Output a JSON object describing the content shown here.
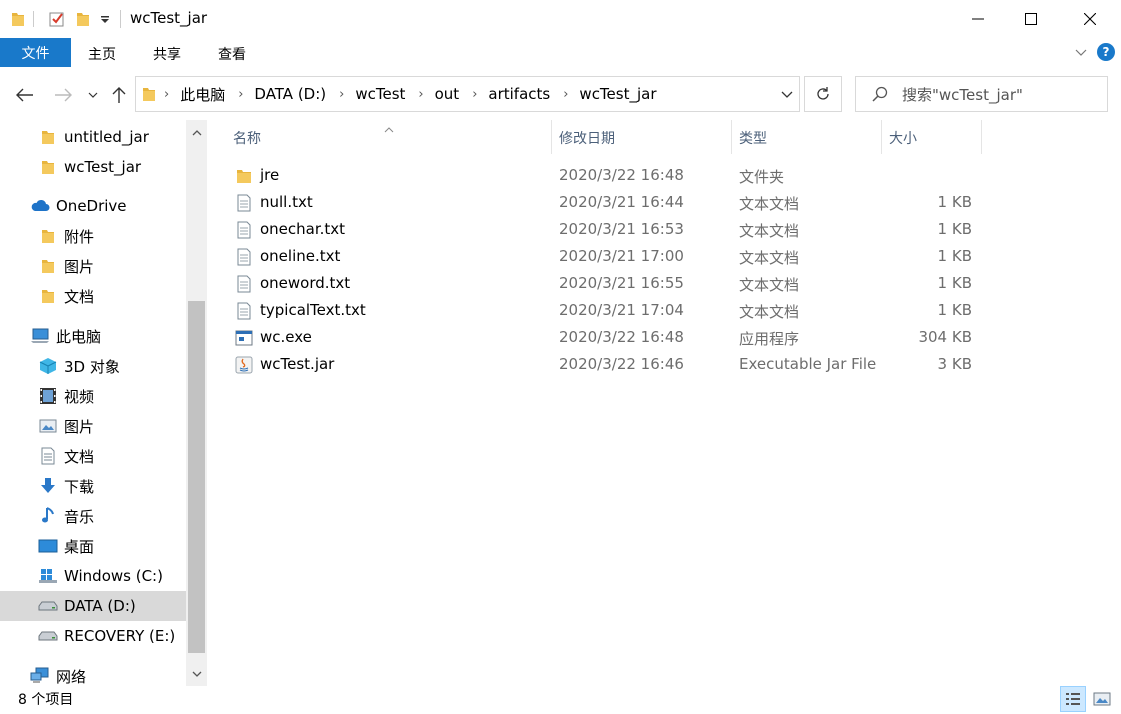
{
  "window": {
    "title": "wcTest_jar",
    "minimize": "—",
    "maximize": "☐",
    "close": "✕"
  },
  "ribbon": {
    "tabs": [
      "文件",
      "主页",
      "共享",
      "查看"
    ],
    "help": "?"
  },
  "address": {
    "crumbs": [
      "此电脑",
      "DATA (D:)",
      "wcTest",
      "out",
      "artifacts",
      "wcTest_jar"
    ]
  },
  "search": {
    "placeholder": "搜索\"wcTest_jar\""
  },
  "sidebar": {
    "items": [
      {
        "label": "untitled_jar",
        "icon": "folder-icon"
      },
      {
        "label": "wcTest_jar",
        "icon": "folder-icon"
      },
      {
        "label": "OneDrive",
        "icon": "cloud-icon"
      },
      {
        "label": "附件",
        "icon": "folder-icon"
      },
      {
        "label": "图片",
        "icon": "folder-icon"
      },
      {
        "label": "文档",
        "icon": "folder-icon"
      },
      {
        "label": "此电脑",
        "icon": "computer-icon"
      },
      {
        "label": "3D 对象",
        "icon": "3d-objects-icon"
      },
      {
        "label": "视频",
        "icon": "video-icon"
      },
      {
        "label": "图片",
        "icon": "pictures-icon"
      },
      {
        "label": "文档",
        "icon": "documents-icon"
      },
      {
        "label": "下载",
        "icon": "download-icon"
      },
      {
        "label": "音乐",
        "icon": "music-icon"
      },
      {
        "label": "桌面",
        "icon": "desktop-icon"
      },
      {
        "label": "Windows (C:)",
        "icon": "windows-drive-icon"
      },
      {
        "label": "DATA (D:)",
        "icon": "drive-icon"
      },
      {
        "label": "RECOVERY (E:)",
        "icon": "drive-icon"
      },
      {
        "label": "网络",
        "icon": "network-icon"
      }
    ]
  },
  "columns": {
    "name": "名称",
    "date": "修改日期",
    "type": "类型",
    "size": "大小"
  },
  "files": [
    {
      "name": "jre",
      "date": "2020/3/22 16:48",
      "type": "文件夹",
      "size": "",
      "icon": "folder-icon"
    },
    {
      "name": "null.txt",
      "date": "2020/3/21 16:44",
      "type": "文本文档",
      "size": "1 KB",
      "icon": "text-file-icon"
    },
    {
      "name": "onechar.txt",
      "date": "2020/3/21 16:53",
      "type": "文本文档",
      "size": "1 KB",
      "icon": "text-file-icon"
    },
    {
      "name": "oneline.txt",
      "date": "2020/3/21 17:00",
      "type": "文本文档",
      "size": "1 KB",
      "icon": "text-file-icon"
    },
    {
      "name": "oneword.txt",
      "date": "2020/3/21 16:55",
      "type": "文本文档",
      "size": "1 KB",
      "icon": "text-file-icon"
    },
    {
      "name": "typicalText.txt",
      "date": "2020/3/21 17:04",
      "type": "文本文档",
      "size": "1 KB",
      "icon": "text-file-icon"
    },
    {
      "name": "wc.exe",
      "date": "2020/3/22 16:48",
      "type": "应用程序",
      "size": "304 KB",
      "icon": "exe-icon"
    },
    {
      "name": "wcTest.jar",
      "date": "2020/3/22 16:46",
      "type": "Executable Jar File",
      "size": "3 KB",
      "icon": "jar-icon"
    }
  ],
  "status": {
    "count": "8 个项目"
  },
  "colors": {
    "accent": "#1979ca",
    "folder": "#e8b53e",
    "selected": "#d9d9d9"
  }
}
